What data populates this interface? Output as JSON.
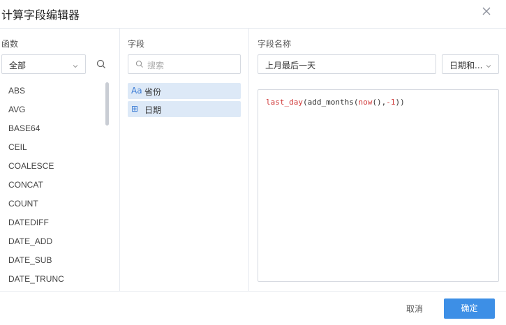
{
  "dialog": {
    "title": "计算字段编辑器",
    "close_icon": "close-icon"
  },
  "functions_panel": {
    "label": "函数",
    "category_select": {
      "value": "全部",
      "icon": "chevron-down-icon"
    },
    "search_icon": "search-icon",
    "items": [
      "ABS",
      "AVG",
      "BASE64",
      "CEIL",
      "COALESCE",
      "CONCAT",
      "COUNT",
      "DATEDIFF",
      "DATE_ADD",
      "DATE_SUB",
      "DATE_TRUNC"
    ]
  },
  "fields_panel": {
    "label": "字段",
    "search": {
      "placeholder": "搜索",
      "icon": "search-icon"
    },
    "items": [
      {
        "icon_text": "Aa",
        "icon": "text-type-icon",
        "label": "省份"
      },
      {
        "icon_text": "⊞",
        "icon": "calendar-type-icon",
        "label": "日期"
      }
    ]
  },
  "editor_panel": {
    "label": "字段名称",
    "name_value": "上月最后一天",
    "type_select": {
      "value": "日期和...",
      "icon": "chevron-down-icon"
    },
    "formula": {
      "tokens": [
        {
          "text": "last_day",
          "kind": "fn"
        },
        {
          "text": "(add_months(",
          "kind": "txt"
        },
        {
          "text": "now",
          "kind": "fn"
        },
        {
          "text": "(),",
          "kind": "txt"
        },
        {
          "text": "-1",
          "kind": "num"
        },
        {
          "text": "))",
          "kind": "txt"
        }
      ]
    }
  },
  "footer": {
    "cancel_label": "取消",
    "confirm_label": "确定"
  },
  "colors": {
    "accent": "#3d8fe6",
    "selected_bg": "#dde9f7",
    "function_token": "#d03a3a",
    "border": "#d5d9e0"
  }
}
